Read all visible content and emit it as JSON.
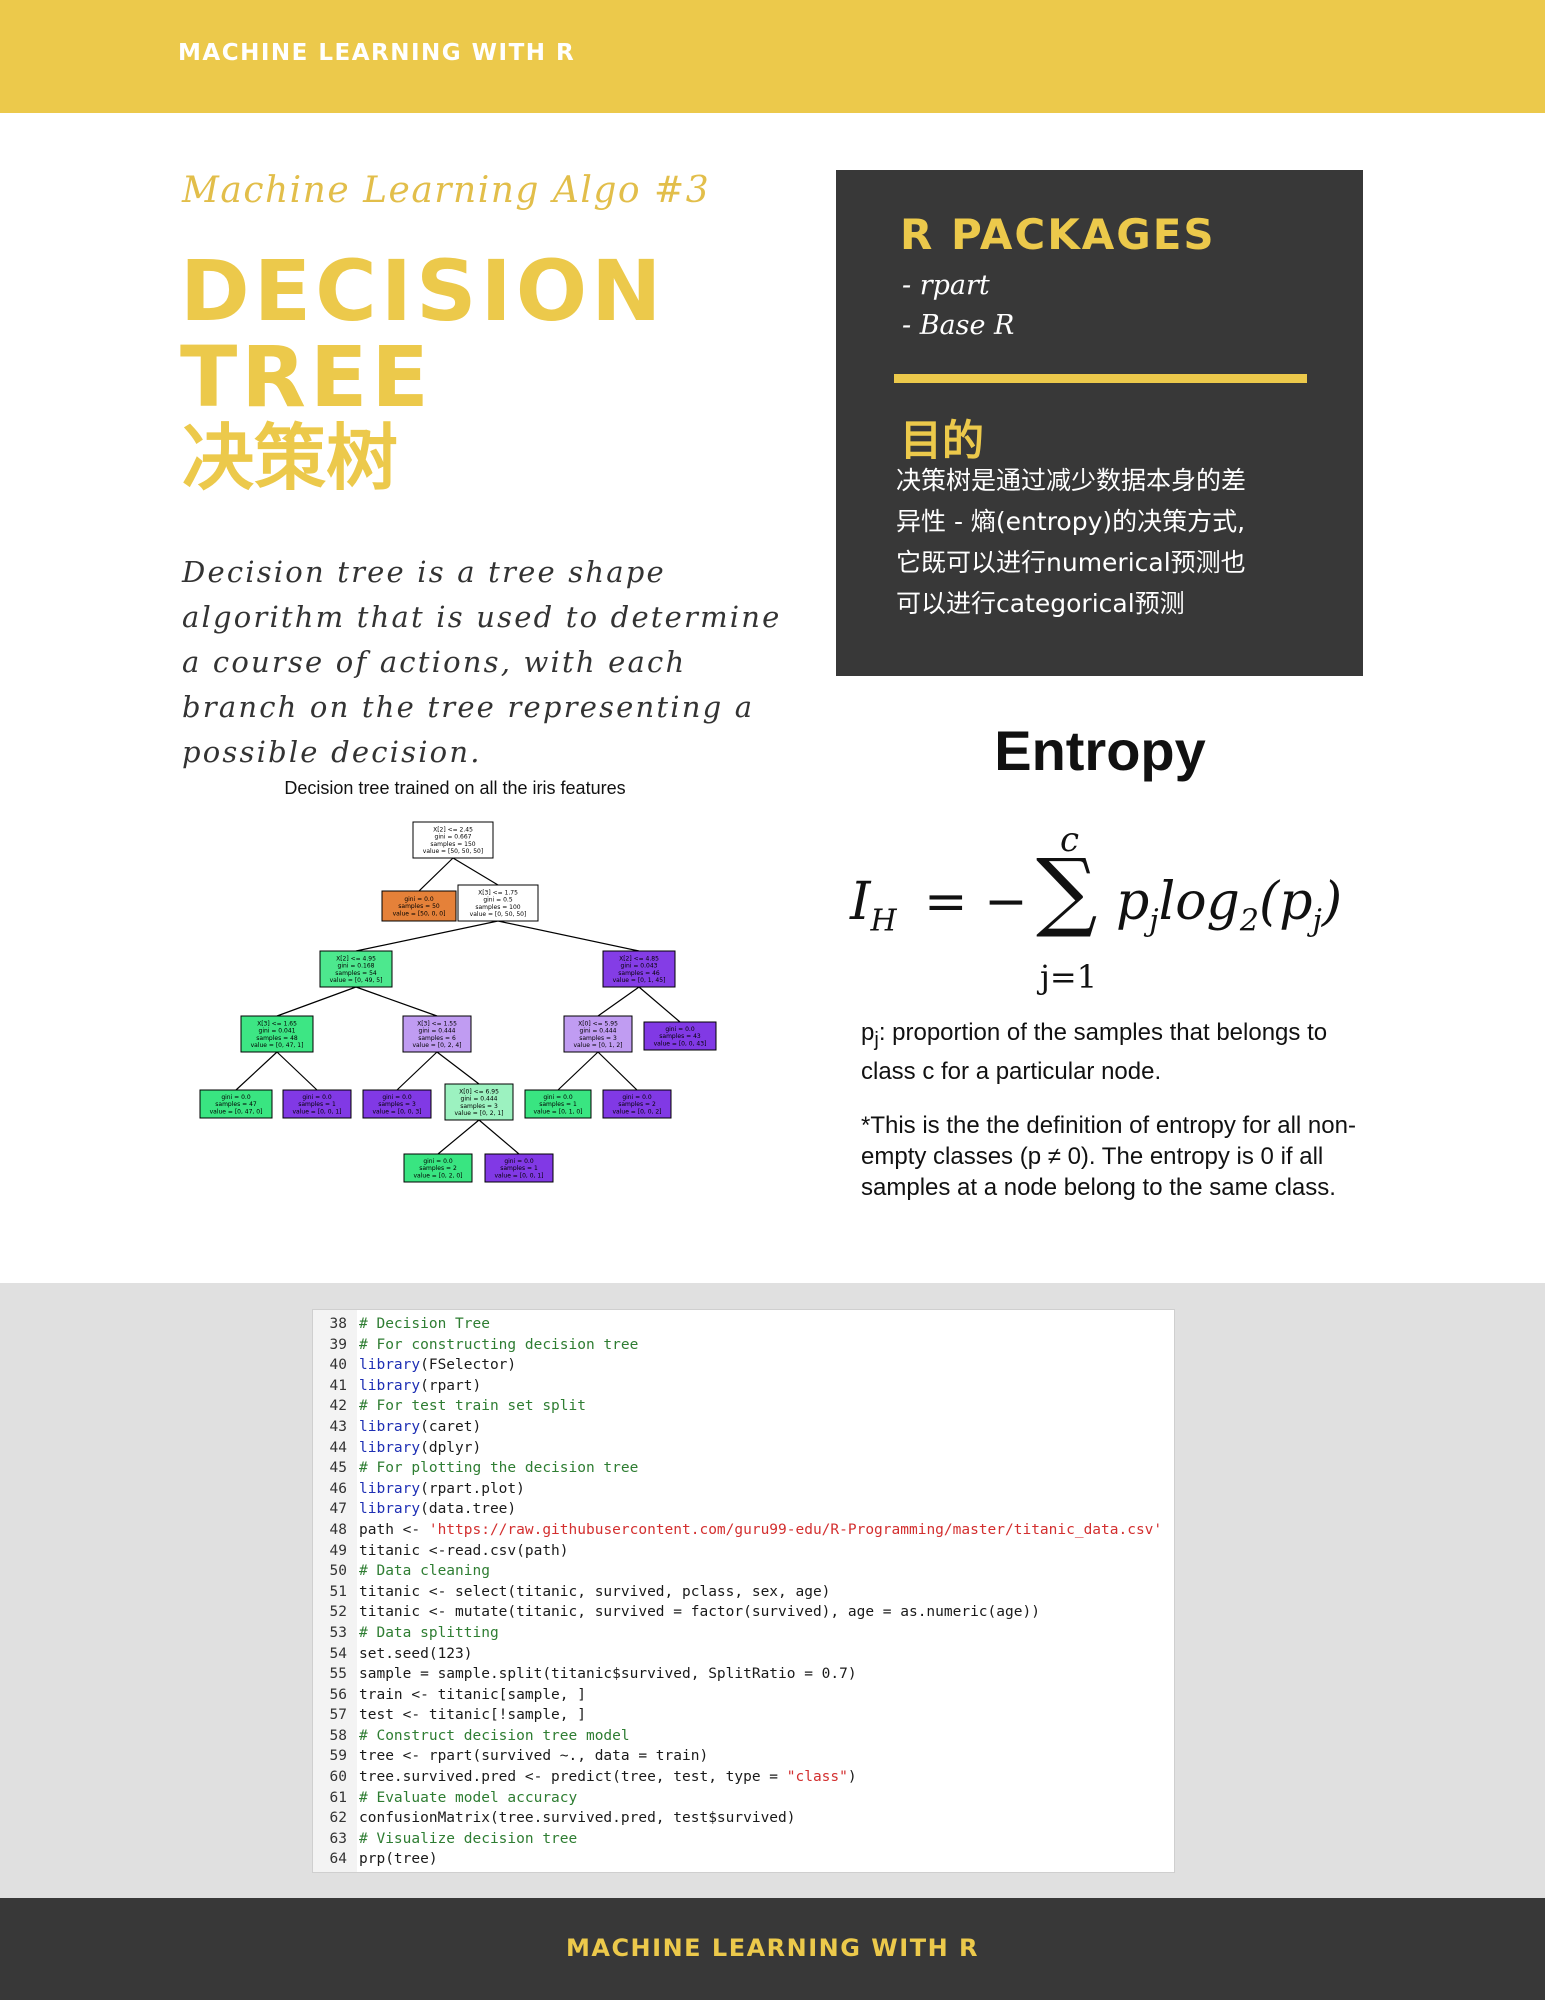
{
  "header": {
    "title": "MACHINE LEARNING WITH R"
  },
  "hero": {
    "kicker": "Machine Learning Algo #3",
    "title_line1": "DECISION",
    "title_line2": "TREE",
    "title_zh": "决策树",
    "description": "Decision tree is a tree shape algorithm that is used to determine a course of actions, with each branch on the tree representing a possible decision."
  },
  "packages": {
    "heading": "R PACKAGES",
    "items": [
      "- rpart",
      "- Base R"
    ]
  },
  "purpose": {
    "heading": "目的",
    "lines": [
      "决策树是通过减少数据本身的差",
      "异性 - 熵(entropy)的决策方式,",
      "它既可以进行numerical预测也",
      "可以进行categorical预测"
    ]
  },
  "tree_figure": {
    "title": "Decision tree trained on all the iris features",
    "colors": {
      "orange": "#E58139",
      "green": "#39E581",
      "purple": "#8139E5",
      "white": "#FFFFFF"
    },
    "nodes": [
      {
        "id": "n0",
        "lines": [
          "X[2] <= 2.45",
          "gini = 0.667",
          "samples = 150",
          "value = [50, 50, 50]"
        ],
        "fill": "#FFFFFF"
      },
      {
        "id": "n1",
        "lines": [
          "gini = 0.0",
          "samples = 50",
          "value = [50, 0, 0]"
        ],
        "fill": "#E58139"
      },
      {
        "id": "n2",
        "lines": [
          "X[3] <= 1.75",
          "gini = 0.5",
          "samples = 100",
          "value = [0, 50, 50]"
        ],
        "fill": "#FFFFFF"
      },
      {
        "id": "n3",
        "lines": [
          "X[2] <= 4.95",
          "gini = 0.168",
          "samples = 54",
          "value = [0, 49, 5]"
        ],
        "fill": "#4DE88E"
      },
      {
        "id": "n4",
        "lines": [
          "X[2] <= 4.85",
          "gini = 0.043",
          "samples = 46",
          "value = [0, 1, 45]"
        ],
        "fill": "#843DE6"
      },
      {
        "id": "n5",
        "lines": [
          "X[3] <= 1.65",
          "gini = 0.041",
          "samples = 48",
          "value = [0, 47, 1]"
        ],
        "fill": "#3DE684"
      },
      {
        "id": "n6",
        "lines": [
          "X[3] <= 1.55",
          "gini = 0.444",
          "samples = 6",
          "value = [0, 2, 4]"
        ],
        "fill": "#C09CF2"
      },
      {
        "id": "n7",
        "lines": [
          "X[0] <= 5.95",
          "gini = 0.444",
          "samples = 3",
          "value = [0, 1, 2]"
        ],
        "fill": "#C09CF2"
      },
      {
        "id": "n8",
        "lines": [
          "gini = 0.0",
          "samples = 43",
          "value = [0, 0, 43]"
        ],
        "fill": "#8139E5"
      },
      {
        "id": "n9",
        "lines": [
          "gini = 0.0",
          "samples = 47",
          "value = [0, 47, 0]"
        ],
        "fill": "#39E581"
      },
      {
        "id": "n10",
        "lines": [
          "gini = 0.0",
          "samples = 1",
          "value = [0, 0, 1]"
        ],
        "fill": "#8139E5"
      },
      {
        "id": "n11",
        "lines": [
          "gini = 0.0",
          "samples = 3",
          "value = [0, 0, 3]"
        ],
        "fill": "#8139E5"
      },
      {
        "id": "n12",
        "lines": [
          "X[0] <= 6.95",
          "gini = 0.444",
          "samples = 3",
          "value = [0, 2, 1]"
        ],
        "fill": "#9CF2C0"
      },
      {
        "id": "n13",
        "lines": [
          "gini = 0.0",
          "samples = 1",
          "value = [0, 1, 0]"
        ],
        "fill": "#39E581"
      },
      {
        "id": "n14",
        "lines": [
          "gini = 0.0",
          "samples = 2",
          "value = [0, 0, 2]"
        ],
        "fill": "#8139E5"
      },
      {
        "id": "n15",
        "lines": [
          "gini = 0.0",
          "samples = 2",
          "value = [0, 2, 0]"
        ],
        "fill": "#39E581"
      },
      {
        "id": "n16",
        "lines": [
          "gini = 0.0",
          "samples = 1",
          "value = [0, 0, 1]"
        ],
        "fill": "#8139E5"
      }
    ],
    "edges": [
      [
        "n0",
        "n1"
      ],
      [
        "n0",
        "n2"
      ],
      [
        "n2",
        "n3"
      ],
      [
        "n2",
        "n4"
      ],
      [
        "n3",
        "n5"
      ],
      [
        "n3",
        "n6"
      ],
      [
        "n4",
        "n7"
      ],
      [
        "n4",
        "n8"
      ],
      [
        "n5",
        "n9"
      ],
      [
        "n5",
        "n10"
      ],
      [
        "n6",
        "n11"
      ],
      [
        "n6",
        "n12"
      ],
      [
        "n7",
        "n13"
      ],
      [
        "n7",
        "n14"
      ],
      [
        "n12",
        "n15"
      ],
      [
        "n12",
        "n16"
      ]
    ]
  },
  "entropy": {
    "title": "Entropy",
    "formula": {
      "lhs": "I",
      "lhs_sub": "H",
      "equals": "= −",
      "sigma": "∑",
      "upper": "c",
      "lower": "j=1",
      "rhs": "p",
      "rhs_sub": "j",
      "rhs_mid": "log",
      "rhs_sub2": "2",
      "rhs_tail1": "(p",
      "rhs_sub3": "j",
      "rhs_tail2": ")"
    },
    "note1_p": "p",
    "note1_sub": "j",
    "note1_text": ": proportion of the samples that belongs to class c for a particular node.",
    "note2": "*This is the the definition of entropy for all non-empty classes (p ≠ 0). The entropy is 0 if all samples at a node belong to the same class."
  },
  "code": {
    "colors": {
      "comment": "#2E7D32",
      "library": "#1E2FB4",
      "string": "#D32F2F"
    },
    "lines": [
      {
        "n": "38",
        "segs": [
          [
            "c",
            "# Decision Tree"
          ]
        ]
      },
      {
        "n": "39",
        "segs": [
          [
            "c",
            "# For constructing decision tree"
          ]
        ]
      },
      {
        "n": "40",
        "segs": [
          [
            "k",
            "library"
          ],
          [
            "t",
            "(FSelector)"
          ]
        ]
      },
      {
        "n": "41",
        "segs": [
          [
            "k",
            "library"
          ],
          [
            "t",
            "(rpart)"
          ]
        ]
      },
      {
        "n": "42",
        "segs": [
          [
            "c",
            "# For test train set split"
          ]
        ]
      },
      {
        "n": "43",
        "segs": [
          [
            "k",
            "library"
          ],
          [
            "t",
            "(caret)"
          ]
        ]
      },
      {
        "n": "44",
        "segs": [
          [
            "k",
            "library"
          ],
          [
            "t",
            "(dplyr)"
          ]
        ]
      },
      {
        "n": "45",
        "segs": [
          [
            "c",
            "# For plotting the decision tree"
          ]
        ]
      },
      {
        "n": "46",
        "segs": [
          [
            "k",
            "library"
          ],
          [
            "t",
            "(rpart.plot)"
          ]
        ]
      },
      {
        "n": "47",
        "segs": [
          [
            "k",
            "library"
          ],
          [
            "t",
            "(data.tree)"
          ]
        ]
      },
      {
        "n": "48",
        "segs": [
          [
            "t",
            "path <- "
          ],
          [
            "s",
            "'https://raw.githubusercontent.com/guru99-edu/R-Programming/master/titanic_data.csv'"
          ]
        ]
      },
      {
        "n": "49",
        "segs": [
          [
            "t",
            "titanic <-read.csv(path)"
          ]
        ]
      },
      {
        "n": "50",
        "segs": [
          [
            "c",
            "# Data cleaning"
          ]
        ]
      },
      {
        "n": "51",
        "segs": [
          [
            "t",
            "titanic <- select(titanic, survived, pclass, sex, age)"
          ]
        ]
      },
      {
        "n": "52",
        "segs": [
          [
            "t",
            "titanic <- mutate(titanic, survived = factor(survived), age = as.numeric(age))"
          ]
        ]
      },
      {
        "n": "53",
        "segs": [
          [
            "c",
            "# Data splitting"
          ]
        ]
      },
      {
        "n": "54",
        "segs": [
          [
            "t",
            "set.seed(123)"
          ]
        ]
      },
      {
        "n": "55",
        "segs": [
          [
            "t",
            "sample = sample.split(titanic$survived, SplitRatio = 0.7)"
          ]
        ]
      },
      {
        "n": "56",
        "segs": [
          [
            "t",
            "train <- titanic[sample, ]"
          ]
        ]
      },
      {
        "n": "57",
        "segs": [
          [
            "t",
            "test <- titanic[!sample, ]"
          ]
        ]
      },
      {
        "n": "58",
        "segs": [
          [
            "c",
            "# Construct decision tree model"
          ]
        ]
      },
      {
        "n": "59",
        "segs": [
          [
            "t",
            "tree <- rpart(survived ~., data = train)"
          ]
        ]
      },
      {
        "n": "60",
        "segs": [
          [
            "t",
            "tree.survived.pred <- predict(tree, test, type = "
          ],
          [
            "s",
            "\"class\""
          ],
          [
            "t",
            ")"
          ]
        ]
      },
      {
        "n": "61",
        "segs": [
          [
            "c",
            "# Evaluate model accuracy"
          ]
        ]
      },
      {
        "n": "62",
        "segs": [
          [
            "t",
            "confusionMatrix(tree.survived.pred, test$survived)"
          ]
        ]
      },
      {
        "n": "63",
        "segs": [
          [
            "c",
            "# Visualize decision tree"
          ]
        ]
      },
      {
        "n": "64",
        "segs": [
          [
            "t",
            "prp(tree)"
          ]
        ]
      }
    ]
  },
  "footer": {
    "title": "MACHINE LEARNING WITH R"
  }
}
